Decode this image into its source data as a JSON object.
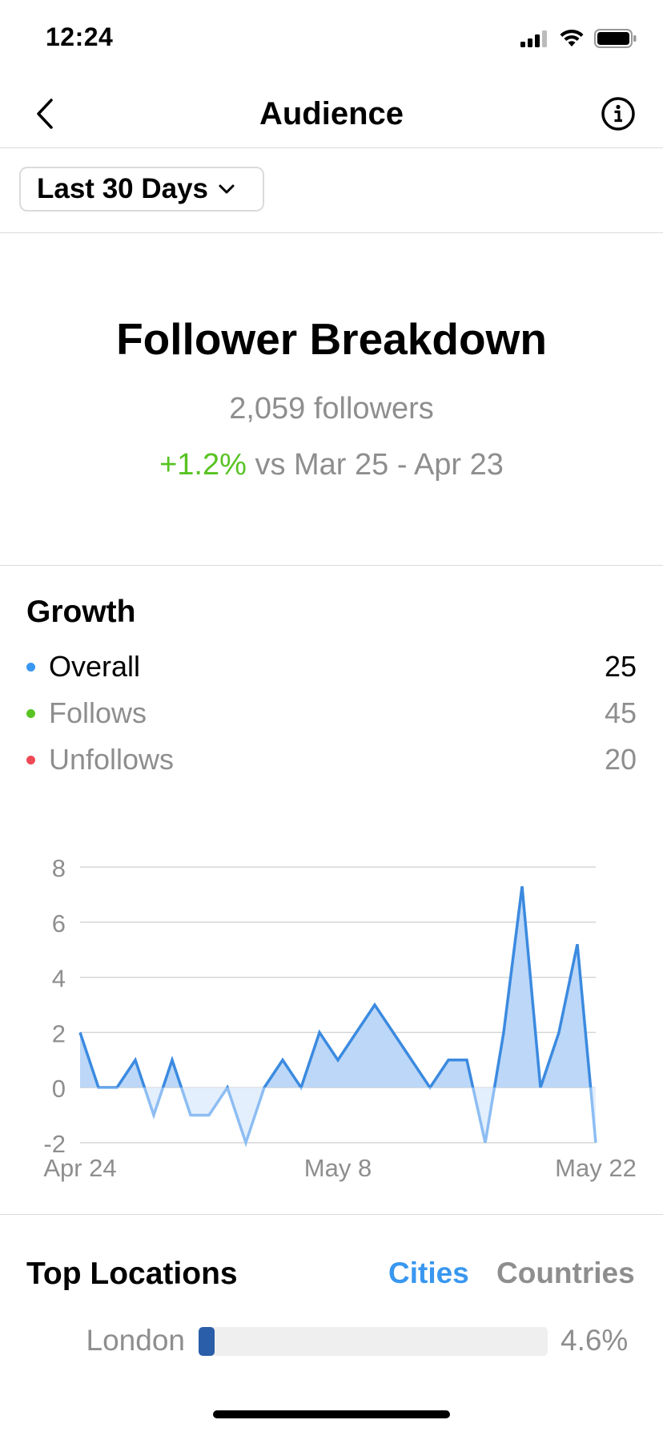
{
  "status": {
    "time": "12:24"
  },
  "nav": {
    "title": "Audience",
    "back_icon": "chevron-left-icon",
    "info_icon": "info-icon"
  },
  "filter": {
    "label": "Last 30 Days",
    "icon": "chevron-down-icon"
  },
  "breakdown": {
    "title": "Follower Breakdown",
    "followers": "2,059 followers",
    "change_pct": "+1.2%",
    "change_text": "vs Mar 25 - Apr 23"
  },
  "growth": {
    "title": "Growth",
    "legend": [
      {
        "label": "Overall",
        "value": "25",
        "color": "#3897f0",
        "text_color": "#000000"
      },
      {
        "label": "Follows",
        "value": "45",
        "color": "#58c322",
        "text_color": "#8e8e8e"
      },
      {
        "label": "Unfollows",
        "value": "20",
        "color": "#ed4956",
        "text_color": "#8e8e8e"
      }
    ]
  },
  "chart_data": {
    "type": "area",
    "title": "",
    "xlabel": "",
    "ylabel": "",
    "x_tick_labels": [
      "Apr 24",
      "May 8",
      "May 22"
    ],
    "y_ticks": [
      8,
      6,
      4,
      2,
      0,
      -2
    ],
    "ylim": [
      -2,
      8
    ],
    "grid": true,
    "series": [
      {
        "color": "#3b8ae0",
        "values": [
          2,
          0,
          0,
          1,
          -1,
          1,
          -1,
          -1,
          0,
          -2,
          0,
          1,
          0,
          2,
          1,
          2,
          3,
          2,
          1,
          0,
          1,
          1,
          -2,
          2,
          7.3,
          0,
          2,
          5.2,
          -2
        ]
      }
    ]
  },
  "locations": {
    "title": "Top Locations",
    "tabs": [
      "Cities",
      "Countries"
    ],
    "active_tab_color": "#3897f0",
    "rows": [
      {
        "city": "London",
        "percent": "4.6%",
        "fraction": 0.046
      }
    ]
  }
}
